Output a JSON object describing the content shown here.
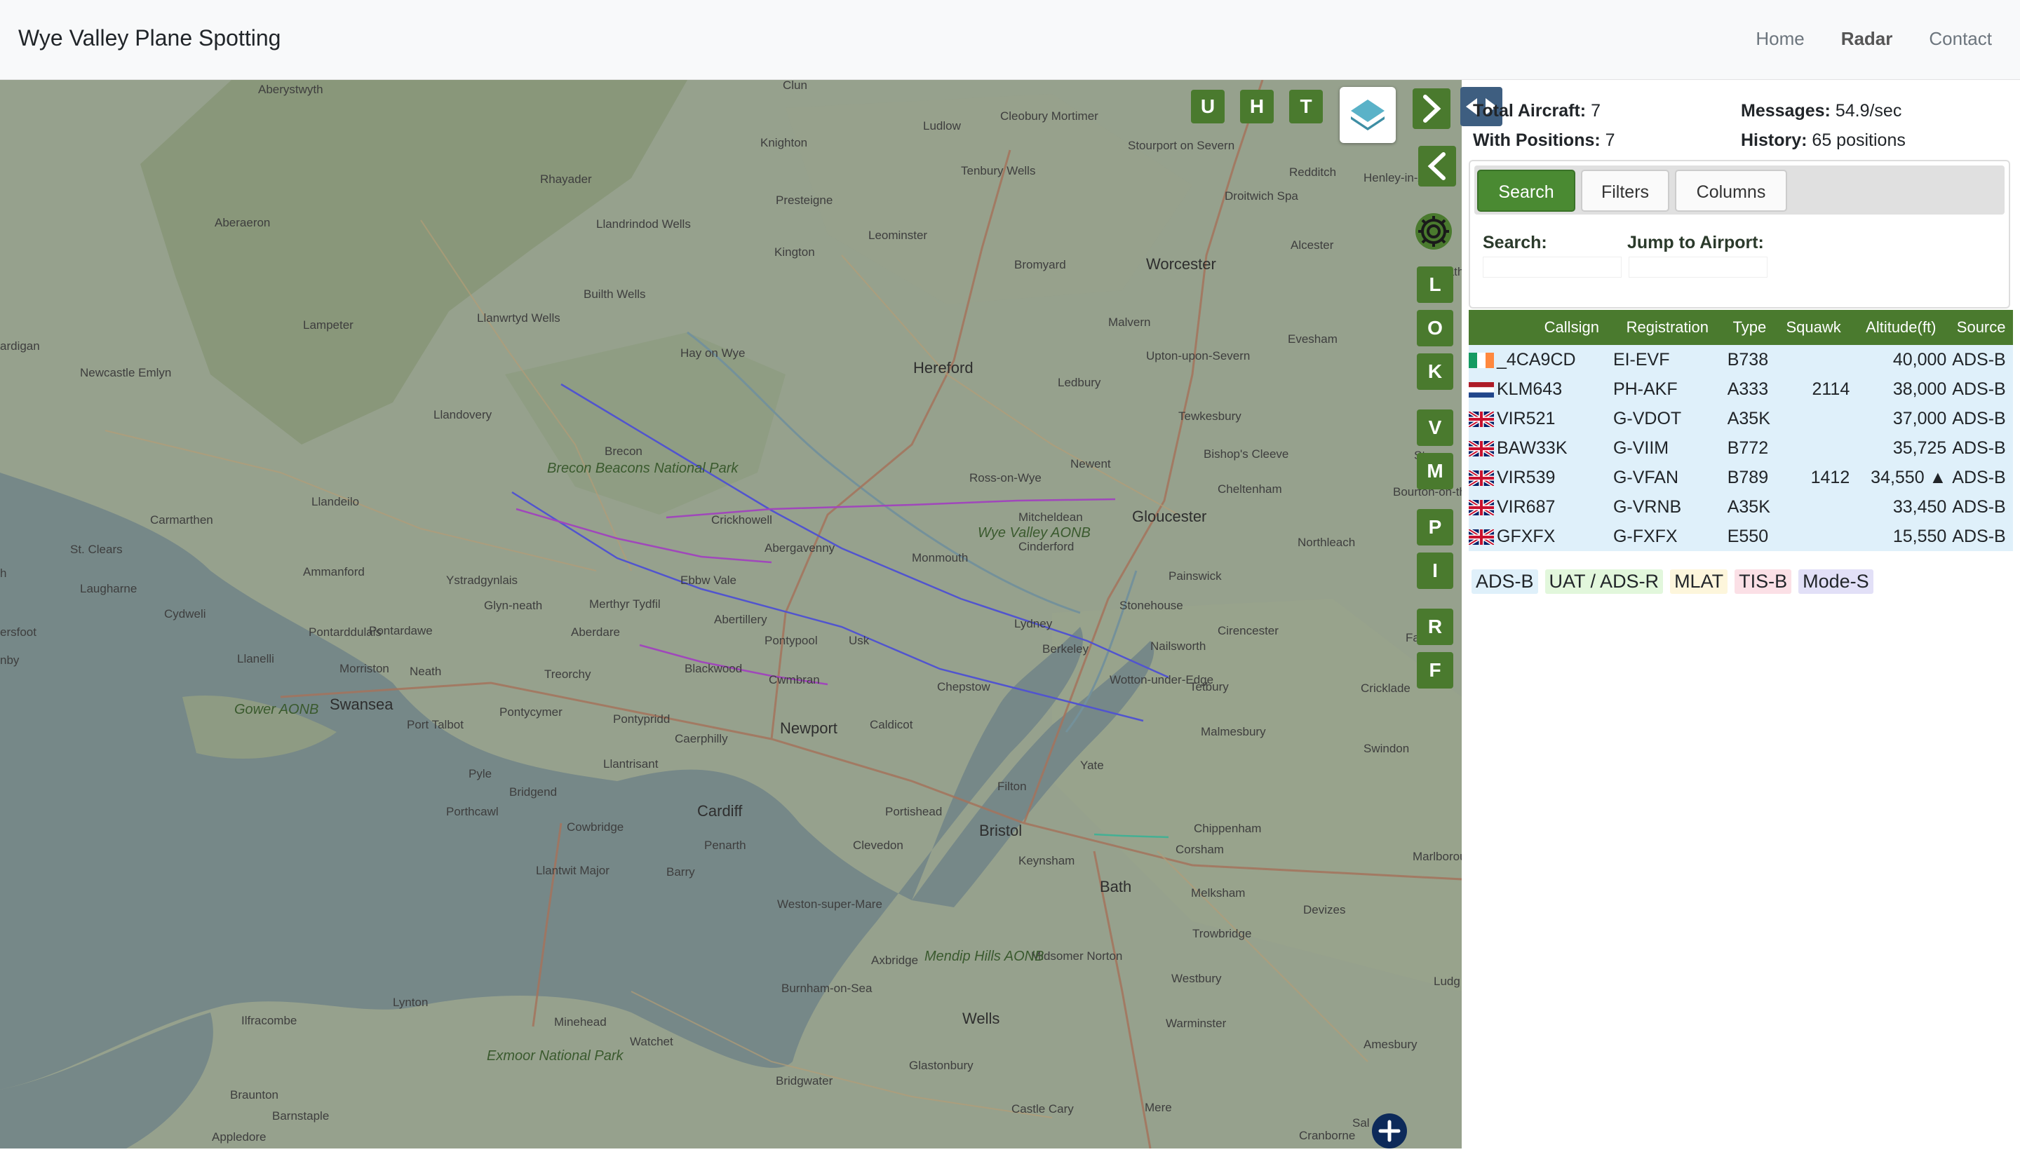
{
  "navbar": {
    "brand": "Wye Valley Plane Spotting",
    "links": [
      "Home",
      "Radar",
      "Contact"
    ],
    "active": "Radar"
  },
  "map": {
    "places": [
      {
        "name": "Aberystwyth",
        "big": false
      },
      {
        "name": "Clun",
        "big": false
      },
      {
        "name": "Cleobury Mortimer",
        "big": false
      },
      {
        "name": "Knighton",
        "big": false
      },
      {
        "name": "Ludlow",
        "big": false
      },
      {
        "name": "Stourport on Severn",
        "big": false
      },
      {
        "name": "Tenbury Wells",
        "big": false
      },
      {
        "name": "Redditch",
        "big": false
      },
      {
        "name": "Rhayader",
        "big": false
      },
      {
        "name": "Presteigne",
        "big": false
      },
      {
        "name": "Droitwich Spa",
        "big": false
      },
      {
        "name": "Henley-in-Arden",
        "big": false
      },
      {
        "name": "Aberaeron",
        "big": false
      },
      {
        "name": "Llandrindod Wells",
        "big": false
      },
      {
        "name": "Leominster",
        "big": false
      },
      {
        "name": "Kington",
        "big": false
      },
      {
        "name": "Bromyard",
        "big": false
      },
      {
        "name": "Worcester",
        "big": true
      },
      {
        "name": "Alcester",
        "big": false
      },
      {
        "name": "Builth Wells",
        "big": false
      },
      {
        "name": "Malvern",
        "big": false
      },
      {
        "name": "Lampeter",
        "big": false
      },
      {
        "name": "Llanwrtyd Wells",
        "big": false
      },
      {
        "name": "Hay on Wye",
        "big": false
      },
      {
        "name": "Hereford",
        "big": true
      },
      {
        "name": "Evesham",
        "big": false
      },
      {
        "name": "Upton-upon-Severn",
        "big": false
      },
      {
        "name": "Newcastle Emlyn",
        "big": false
      },
      {
        "name": "Ledbury",
        "big": false
      },
      {
        "name": "Llandovery",
        "big": false
      },
      {
        "name": "Tewkesbury",
        "big": false
      },
      {
        "name": "Brecon",
        "big": false
      },
      {
        "name": "Bishop's Cleeve",
        "big": false
      },
      {
        "name": "Newent",
        "big": false
      },
      {
        "name": "Ross-on-Wye",
        "big": false
      },
      {
        "name": "Llandeilo",
        "big": false
      },
      {
        "name": "Cheltenham",
        "big": false
      },
      {
        "name": "Carmarthen",
        "big": false
      },
      {
        "name": "Crickhowell",
        "big": false
      },
      {
        "name": "Mitcheldean",
        "big": false
      },
      {
        "name": "Gloucester",
        "big": true
      },
      {
        "name": "St. Clears",
        "big": false
      },
      {
        "name": "Abergavenny",
        "big": false
      },
      {
        "name": "Monmouth",
        "big": false
      },
      {
        "name": "Cinderford",
        "big": false
      },
      {
        "name": "Northleach",
        "big": false
      },
      {
        "name": "Ammanford",
        "big": false
      },
      {
        "name": "Laugharne",
        "big": false
      },
      {
        "name": "Ystradgynlais",
        "big": false
      },
      {
        "name": "Ebbw Vale",
        "big": false
      },
      {
        "name": "Painswick",
        "big": false
      },
      {
        "name": "Glyn-neath",
        "big": false
      },
      {
        "name": "Merthyr Tydfil",
        "big": false
      },
      {
        "name": "Stonehouse",
        "big": false
      },
      {
        "name": "Cydweli",
        "big": false
      },
      {
        "name": "Abertillery",
        "big": false
      },
      {
        "name": "Lydney",
        "big": false
      },
      {
        "name": "Pontarddulais",
        "big": false
      },
      {
        "name": "Pontardawe",
        "big": false
      },
      {
        "name": "Aberdare",
        "big": false
      },
      {
        "name": "Pontypool",
        "big": false
      },
      {
        "name": "Usk",
        "big": false
      },
      {
        "name": "Cirencester",
        "big": false
      },
      {
        "name": "Llanelli",
        "big": false
      },
      {
        "name": "Berkeley",
        "big": false
      },
      {
        "name": "Nailsworth",
        "big": false
      },
      {
        "name": "Morriston",
        "big": false
      },
      {
        "name": "Neath",
        "big": false
      },
      {
        "name": "Treorchy",
        "big": false
      },
      {
        "name": "Blackwood",
        "big": false
      },
      {
        "name": "Cwmbran",
        "big": false
      },
      {
        "name": "Wotton-under-Edge",
        "big": false
      },
      {
        "name": "Tetbury",
        "big": false
      },
      {
        "name": "Swansea",
        "big": true
      },
      {
        "name": "Chepstow",
        "big": false
      },
      {
        "name": "Cricklade",
        "big": false
      },
      {
        "name": "Pontycymer",
        "big": false
      },
      {
        "name": "Pontypridd",
        "big": false
      },
      {
        "name": "Caldicot",
        "big": false
      },
      {
        "name": "Malmesbury",
        "big": false
      },
      {
        "name": "Port Talbot",
        "big": false
      },
      {
        "name": "Newport",
        "big": true
      },
      {
        "name": "Caerphilly",
        "big": false
      },
      {
        "name": "Swindon",
        "big": false
      },
      {
        "name": "Yate",
        "big": false
      },
      {
        "name": "Llantrisant",
        "big": false
      },
      {
        "name": "Pyle",
        "big": false
      },
      {
        "name": "Filton",
        "big": false
      },
      {
        "name": "Bridgend",
        "big": false
      },
      {
        "name": "Portishead",
        "big": false
      },
      {
        "name": "Porthcawl",
        "big": false
      },
      {
        "name": "Cardiff",
        "big": true
      },
      {
        "name": "Chippenham",
        "big": false
      },
      {
        "name": "Cowbridge",
        "big": false
      },
      {
        "name": "Penarth",
        "big": false
      },
      {
        "name": "Bristol",
        "big": true
      },
      {
        "name": "Corsham",
        "big": false
      },
      {
        "name": "Clevedon",
        "big": false
      },
      {
        "name": "Marlborough",
        "big": false
      },
      {
        "name": "Keynsham",
        "big": false
      },
      {
        "name": "Llantwit Major",
        "big": false
      },
      {
        "name": "Barry",
        "big": false
      },
      {
        "name": "Bath",
        "big": true
      },
      {
        "name": "Melksham",
        "big": false
      },
      {
        "name": "Devizes",
        "big": false
      },
      {
        "name": "Weston-super-Mare",
        "big": false
      },
      {
        "name": "Trowbridge",
        "big": false
      },
      {
        "name": "Axbridge",
        "big": false
      },
      {
        "name": "Midsomer Norton",
        "big": false
      },
      {
        "name": "Westbury",
        "big": false
      },
      {
        "name": "Burnham-on-Sea",
        "big": false
      },
      {
        "name": "Lynton",
        "big": false
      },
      {
        "name": "Ilfracombe",
        "big": false
      },
      {
        "name": "Minehead",
        "big": false
      },
      {
        "name": "Wells",
        "big": true
      },
      {
        "name": "Warminster",
        "big": false
      },
      {
        "name": "Amesbury",
        "big": false
      },
      {
        "name": "Watchet",
        "big": false
      },
      {
        "name": "Glastonbury",
        "big": false
      },
      {
        "name": "Bridgwater",
        "big": false
      },
      {
        "name": "Braunton",
        "big": false
      },
      {
        "name": "Barnstaple",
        "big": false
      },
      {
        "name": "Castle Cary",
        "big": false
      },
      {
        "name": "Mere",
        "big": false
      },
      {
        "name": "Appledore",
        "big": false
      },
      {
        "name": "Cranborne",
        "big": false
      },
      {
        "name": "Ludg",
        "big": false
      },
      {
        "name": "Stow",
        "big": false
      },
      {
        "name": "Bourton-on-the-Wa",
        "big": false
      },
      {
        "name": "Fairfor",
        "big": false
      },
      {
        "name": "Strath",
        "big": false
      },
      {
        "name": "Sal",
        "big": false
      },
      {
        "name": "ardigan",
        "big": false
      },
      {
        "name": "ersfoot",
        "big": false
      },
      {
        "name": "nby",
        "big": false
      },
      {
        "name": "h",
        "big": false
      }
    ],
    "parks": [
      {
        "name": "Brecon Beacons National Park"
      },
      {
        "name": "Wye Valley AONB"
      },
      {
        "name": "Gower AONB"
      },
      {
        "name": "Mendip Hills AONB"
      },
      {
        "name": "Exmoor National Park"
      }
    ],
    "controls": {
      "top_letters": [
        "U",
        "H",
        "T"
      ],
      "side_letters": [
        "L",
        "O",
        "K",
        "V",
        "M",
        "P",
        "I",
        "R",
        "F"
      ],
      "layer_icon": "layers-icon",
      "next_icon": "chevron-right-icon",
      "prev_icon": "chevron-left-icon",
      "settings_icon": "gear-icon",
      "zoom_icon": "plus-icon"
    },
    "track_colors": {
      "blue": "#5050e8",
      "purple": "#b040d0",
      "teal": "#40c0a0"
    }
  },
  "panel": {
    "toggle_icon": "expand-arrows-icon",
    "stats": {
      "total_label": "Total Aircraft:",
      "total_value": "7",
      "withpos_label": "With Positions:",
      "withpos_value": "7",
      "messages_label": "Messages:",
      "messages_value": "54.9/sec",
      "history_label": "History:",
      "history_value": "65 positions"
    },
    "tabs": [
      "Search",
      "Filters",
      "Columns"
    ],
    "active_tab": "Search",
    "search_label": "Search:",
    "airport_label": "Jump to Airport:",
    "table": {
      "headers": [
        "Callsign",
        "Registration",
        "Type",
        "Squawk",
        "Altitude(ft)",
        "Source"
      ],
      "rows": [
        {
          "flag": "ireland",
          "callsign": "_4CA9CD",
          "reg": "EI-EVF",
          "type": "B738",
          "squawk": "",
          "alt": "40,000",
          "source": "ADS-B"
        },
        {
          "flag": "netherlands",
          "callsign": "KLM643",
          "reg": "PH-AKF",
          "type": "A333",
          "squawk": "2114",
          "alt": "38,000",
          "source": "ADS-B"
        },
        {
          "flag": "uk",
          "callsign": "VIR521",
          "reg": "G-VDOT",
          "type": "A35K",
          "squawk": "",
          "alt": "37,000",
          "source": "ADS-B"
        },
        {
          "flag": "uk",
          "callsign": "BAW33K",
          "reg": "G-VIIM",
          "type": "B772",
          "squawk": "",
          "alt": "35,725",
          "source": "ADS-B"
        },
        {
          "flag": "uk",
          "callsign": "VIR539",
          "reg": "G-VFAN",
          "type": "B789",
          "squawk": "1412",
          "alt": "34,550 ▲",
          "source": "ADS-B"
        },
        {
          "flag": "uk",
          "callsign": "VIR687",
          "reg": "G-VRNB",
          "type": "A35K",
          "squawk": "",
          "alt": "33,450",
          "source": "ADS-B"
        },
        {
          "flag": "uk",
          "callsign": "GFXFX",
          "reg": "G-FXFX",
          "type": "E550",
          "squawk": "",
          "alt": "15,550",
          "source": "ADS-B"
        }
      ]
    },
    "legend": [
      {
        "label": "ADS-B",
        "color": "#dff0fa"
      },
      {
        "label": "UAT / ADS-R",
        "color": "#e2f7dc"
      },
      {
        "label": "MLAT",
        "color": "#fdf6dc"
      },
      {
        "label": "TIS-B",
        "color": "#fbe0e6"
      },
      {
        "label": "Mode-S",
        "color": "#e2e0f7"
      }
    ]
  }
}
